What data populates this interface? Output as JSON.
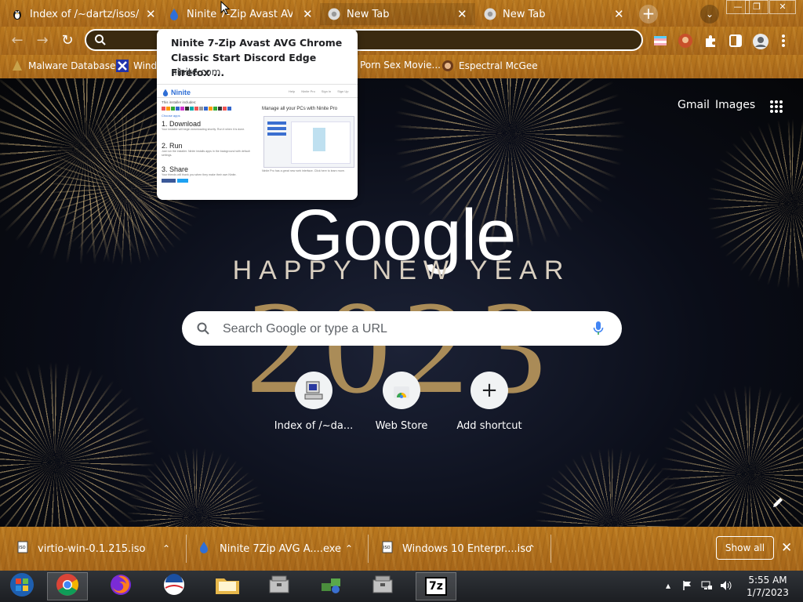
{
  "tabs": [
    {
      "title": "Index of /~dartz/isos/",
      "icon": "linux-penguin-icon",
      "close": "✕"
    },
    {
      "title": "Ninite 7-Zip Avast AVG C",
      "icon": "ninite-icon",
      "close": "✕"
    },
    {
      "title": "New Tab",
      "icon": "chrome-icon",
      "close": "✕",
      "active": true
    },
    {
      "title": "New Tab",
      "icon": "chrome-icon",
      "close": "✕"
    }
  ],
  "tabstrip": {
    "new_tab": "+",
    "tab_search": "⌄"
  },
  "window": {
    "minimize": "—",
    "maximize": "❐",
    "close": "✕"
  },
  "toolbar": {
    "back": "←",
    "forward": "→",
    "reload": "↻",
    "address_value": ""
  },
  "bookmarks": [
    {
      "label": "Malware Database",
      "icon": "bookmark-favicon"
    },
    {
      "label": "Wind",
      "icon": "x-logo-icon"
    },
    {
      "label": "Porn Sex Movie...",
      "icon": "bookmark-favicon"
    },
    {
      "label": "Espectral McGee",
      "icon": "avatar-favicon"
    }
  ],
  "hover_card": {
    "title": "Ninite 7-Zip Avast AVG Chrome Classic Start Discord Edge Firefox ...",
    "url": "ninite.com",
    "thumb": {
      "brand": "Ninite",
      "nav": [
        "Help",
        "Ninite Pro",
        "Sign In",
        "Sign Up"
      ],
      "installer_label": "This installer includes:",
      "edit_label": "Choose apps",
      "steps": [
        {
          "heading": "1. Download",
          "text": "Your installer will begin downloading shortly. Run it when it is done."
        },
        {
          "heading": "2. Run",
          "text": "Just run the installer. Ninite installs apps in the background with default settings."
        },
        {
          "heading": "3. Share",
          "text": "Your friends will thank you when they make their own Ninite."
        }
      ],
      "pro_heading": "Manage all your PCs with Ninite Pro",
      "pro_text": "Ninite Pro has a great new web interface. Click here to learn more."
    }
  },
  "ntp": {
    "gmail": "Gmail",
    "images": "Images",
    "logo": "Google",
    "tagline": "HAPPY NEW YEAR",
    "year": "2023",
    "search_placeholder": "Search Google or type a URL",
    "shortcuts": [
      {
        "label": "Index of /~da...",
        "icon": "computer-icon"
      },
      {
        "label": "Web Store",
        "icon": "web-store-icon"
      },
      {
        "label": "Add shortcut",
        "icon": "plus-icon",
        "glyph": "+"
      }
    ]
  },
  "downloads": {
    "items": [
      {
        "name": "virtio-win-0.1.215.iso",
        "icon": "iso-file-icon"
      },
      {
        "name": "Ninite 7Zip AVG A....exe",
        "icon": "ninite-icon"
      },
      {
        "name": "Windows 10 Enterpr....iso",
        "icon": "iso-file-icon"
      }
    ],
    "chevron": "⌃",
    "show_all": "Show all",
    "close": "✕"
  },
  "taskbar": {
    "apps": [
      "start-orb-icon",
      "chrome-icon",
      "firefox-icon",
      "obama-logo-icon",
      "file-explorer-icon",
      "archive-icon",
      "network-icon",
      "archive-icon",
      "7zip-icon"
    ],
    "seven_zip_label": "7z",
    "tray_arrow": "▴",
    "time": "5:55 AM",
    "date": "1/7/2023"
  }
}
